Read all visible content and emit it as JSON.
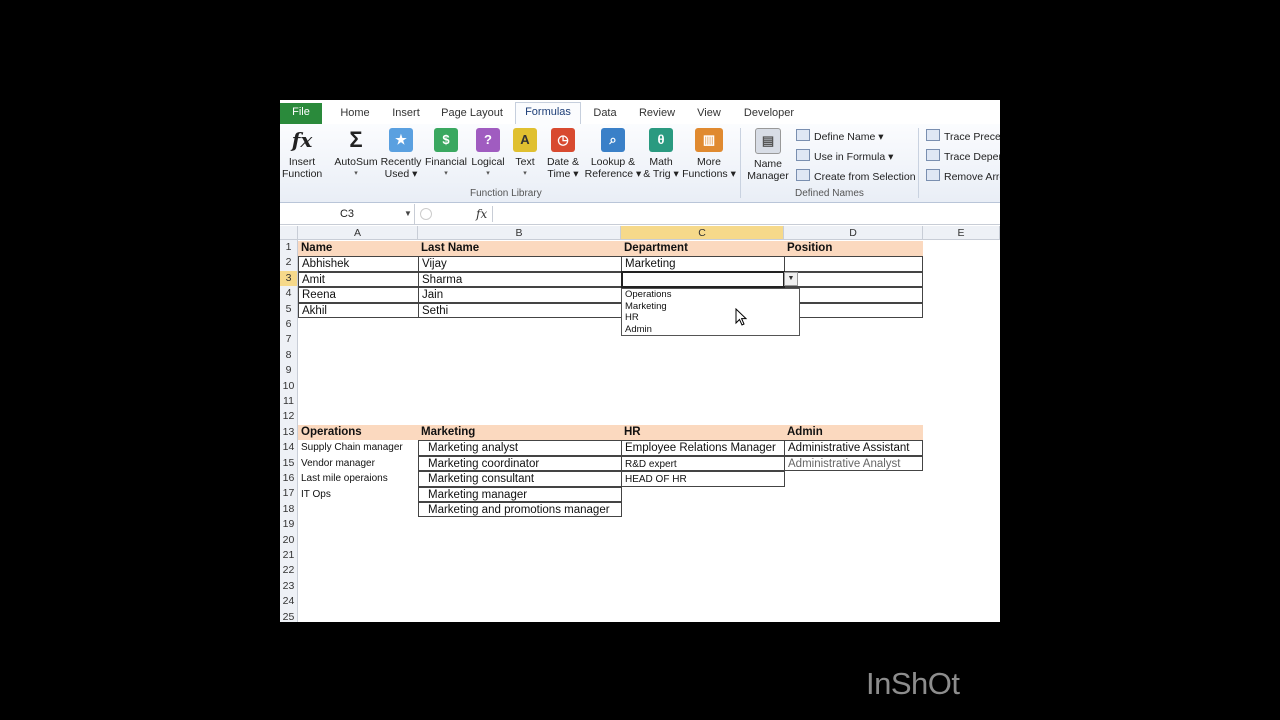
{
  "ribbon": {
    "tabs": [
      "File",
      "Home",
      "Insert",
      "Page Layout",
      "Formulas",
      "Data",
      "Review",
      "View",
      "Developer"
    ],
    "active_tab": "Formulas",
    "function_library": {
      "group_label": "Function Library",
      "buttons": [
        {
          "label1": "Insert",
          "label2": "Function",
          "icon": "fx-icon"
        },
        {
          "label1": "AutoSum",
          "label2": "▾",
          "icon": "sigma-icon"
        },
        {
          "label1": "Recently",
          "label2": "Used ▾",
          "icon": "book-icon"
        },
        {
          "label1": "Financial",
          "label2": "▾",
          "icon": "book-icon"
        },
        {
          "label1": "Logical",
          "label2": "▾",
          "icon": "book-icon"
        },
        {
          "label1": "Text",
          "label2": "▾",
          "icon": "book-icon"
        },
        {
          "label1": "Date &",
          "label2": "Time ▾",
          "icon": "book-icon"
        },
        {
          "label1": "Lookup &",
          "label2": "Reference ▾",
          "icon": "book-icon"
        },
        {
          "label1": "Math",
          "label2": "& Trig ▾",
          "icon": "book-icon"
        },
        {
          "label1": "More",
          "label2": "Functions ▾",
          "icon": "book-icon"
        }
      ]
    },
    "defined_names": {
      "group_label": "Defined Names",
      "name_manager": {
        "label1": "Name",
        "label2": "Manager"
      },
      "define_name": "Define Name ▾",
      "use_in_formula": "Use in Formula ▾",
      "create_from_selection": "Create from Selection"
    },
    "auditing": {
      "trace_precedents": "Trace Preced",
      "trace_dependents": "Trace Depen",
      "remove_arrows": "Remove Arro"
    }
  },
  "formula_bar": {
    "name_box": "C3",
    "fx": "fx",
    "content": ""
  },
  "columns": [
    "A",
    "B",
    "C",
    "D",
    "E"
  ],
  "rows": [
    "1",
    "2",
    "3",
    "4",
    "5",
    "6",
    "7",
    "8",
    "9",
    "10",
    "11",
    "12",
    "13",
    "14",
    "15",
    "16",
    "17",
    "18",
    "19",
    "20",
    "21",
    "22",
    "23",
    "24",
    "25"
  ],
  "table1": {
    "headers": [
      "Name",
      "Last Name",
      "Department",
      "Position"
    ],
    "rows": [
      [
        "Abhishek",
        "Vijay",
        "Marketing",
        ""
      ],
      [
        "Amit",
        "Sharma",
        "",
        ""
      ],
      [
        "Reena",
        "Jain",
        "",
        ""
      ],
      [
        "Akhil",
        "Sethi",
        "",
        ""
      ]
    ]
  },
  "dropdown": {
    "options": [
      "Operations",
      "Marketing",
      "HR",
      "Admin"
    ]
  },
  "table2": {
    "headers": [
      "Operations",
      "Marketing",
      "HR",
      "Admin"
    ],
    "operations": [
      "Supply Chain manager",
      "Vendor manager",
      "Last mile operaions",
      "IT Ops"
    ],
    "marketing": [
      "Marketing analyst",
      "Marketing coordinator",
      "Marketing consultant",
      "Marketing manager",
      "Marketing and promotions manager"
    ],
    "hr": [
      "Employee Relations Manager",
      "R&D expert",
      "HEAD OF HR"
    ],
    "admin": [
      "Administrative Assistant",
      "Administrative Analyst"
    ]
  },
  "watermark": "InShOt",
  "colors": {
    "header_fill": "#fbd9bf",
    "selected_header": "#f6d98a",
    "file_tab": "#2a8a3b"
  }
}
